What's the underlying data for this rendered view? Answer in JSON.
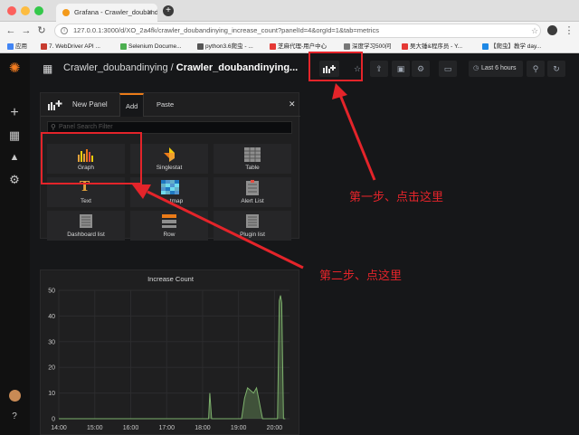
{
  "browser": {
    "tab_title": "Grafana - Crawler_doubandin",
    "url": "127.0.0.1:3000/d/XO_2a4fk/crawler_doubandinying_increase_count?panelId=4&orgId=1&tab=metrics",
    "bookmarks": [
      "应用",
      "7. WebDriver API ...",
      "Selenium Docume...",
      "python3.6爬虫 - ...",
      "芝麻代理-用户中心",
      "深度学习500问",
      "吴大锤&程序员 - Y...",
      "【爬虫】教学 day..."
    ]
  },
  "navbar": {
    "folder": "Crawler_doubandinying /",
    "dashboard": "Crawler_doubandinying...",
    "time_range": "Last 6 hours"
  },
  "addpanel": {
    "title": "New Panel",
    "tabs": [
      "Add",
      "Paste"
    ],
    "search_placeholder": "Panel Search Filter",
    "types": [
      "Graph",
      "Singlestat",
      "Table",
      "Text",
      "Heatmap",
      "Alert List",
      "Dashboard list",
      "Row",
      "Plugin list"
    ],
    "types_visible_heatmap": "tmap"
  },
  "graph": {
    "title": "Increase Count"
  },
  "chart_data": {
    "type": "line",
    "title": "Increase Count",
    "xlabel": "",
    "ylabel": "",
    "categories": [
      "14:00",
      "15:00",
      "16:00",
      "17:00",
      "18:00",
      "19:00",
      "20:00"
    ],
    "ylim": [
      0,
      50
    ],
    "yticks": [
      0,
      10,
      20,
      30,
      40,
      50
    ],
    "series": [
      {
        "x": [
          "14:00",
          "18:10",
          "18:12",
          "18:15",
          "18:25",
          "18:30",
          "18:35",
          "18:45",
          "19:05",
          "19:10",
          "19:15",
          "19:20",
          "19:25",
          "19:30",
          "19:40",
          "19:45",
          "19:50",
          "20:05",
          "20:08",
          "20:10",
          "20:12",
          "20:15",
          "20:18"
        ],
        "values": [
          0,
          0,
          10,
          0,
          0,
          0,
          0,
          0,
          0,
          8,
          12,
          11,
          10,
          12,
          0,
          0,
          0,
          0,
          46,
          48,
          45,
          0,
          0
        ]
      }
    ],
    "grid": true,
    "color": "#7eb26d"
  },
  "annotations": {
    "step1": "第一步、点击这里",
    "step2": "第二步、点这里",
    "color": "#e4242a"
  }
}
